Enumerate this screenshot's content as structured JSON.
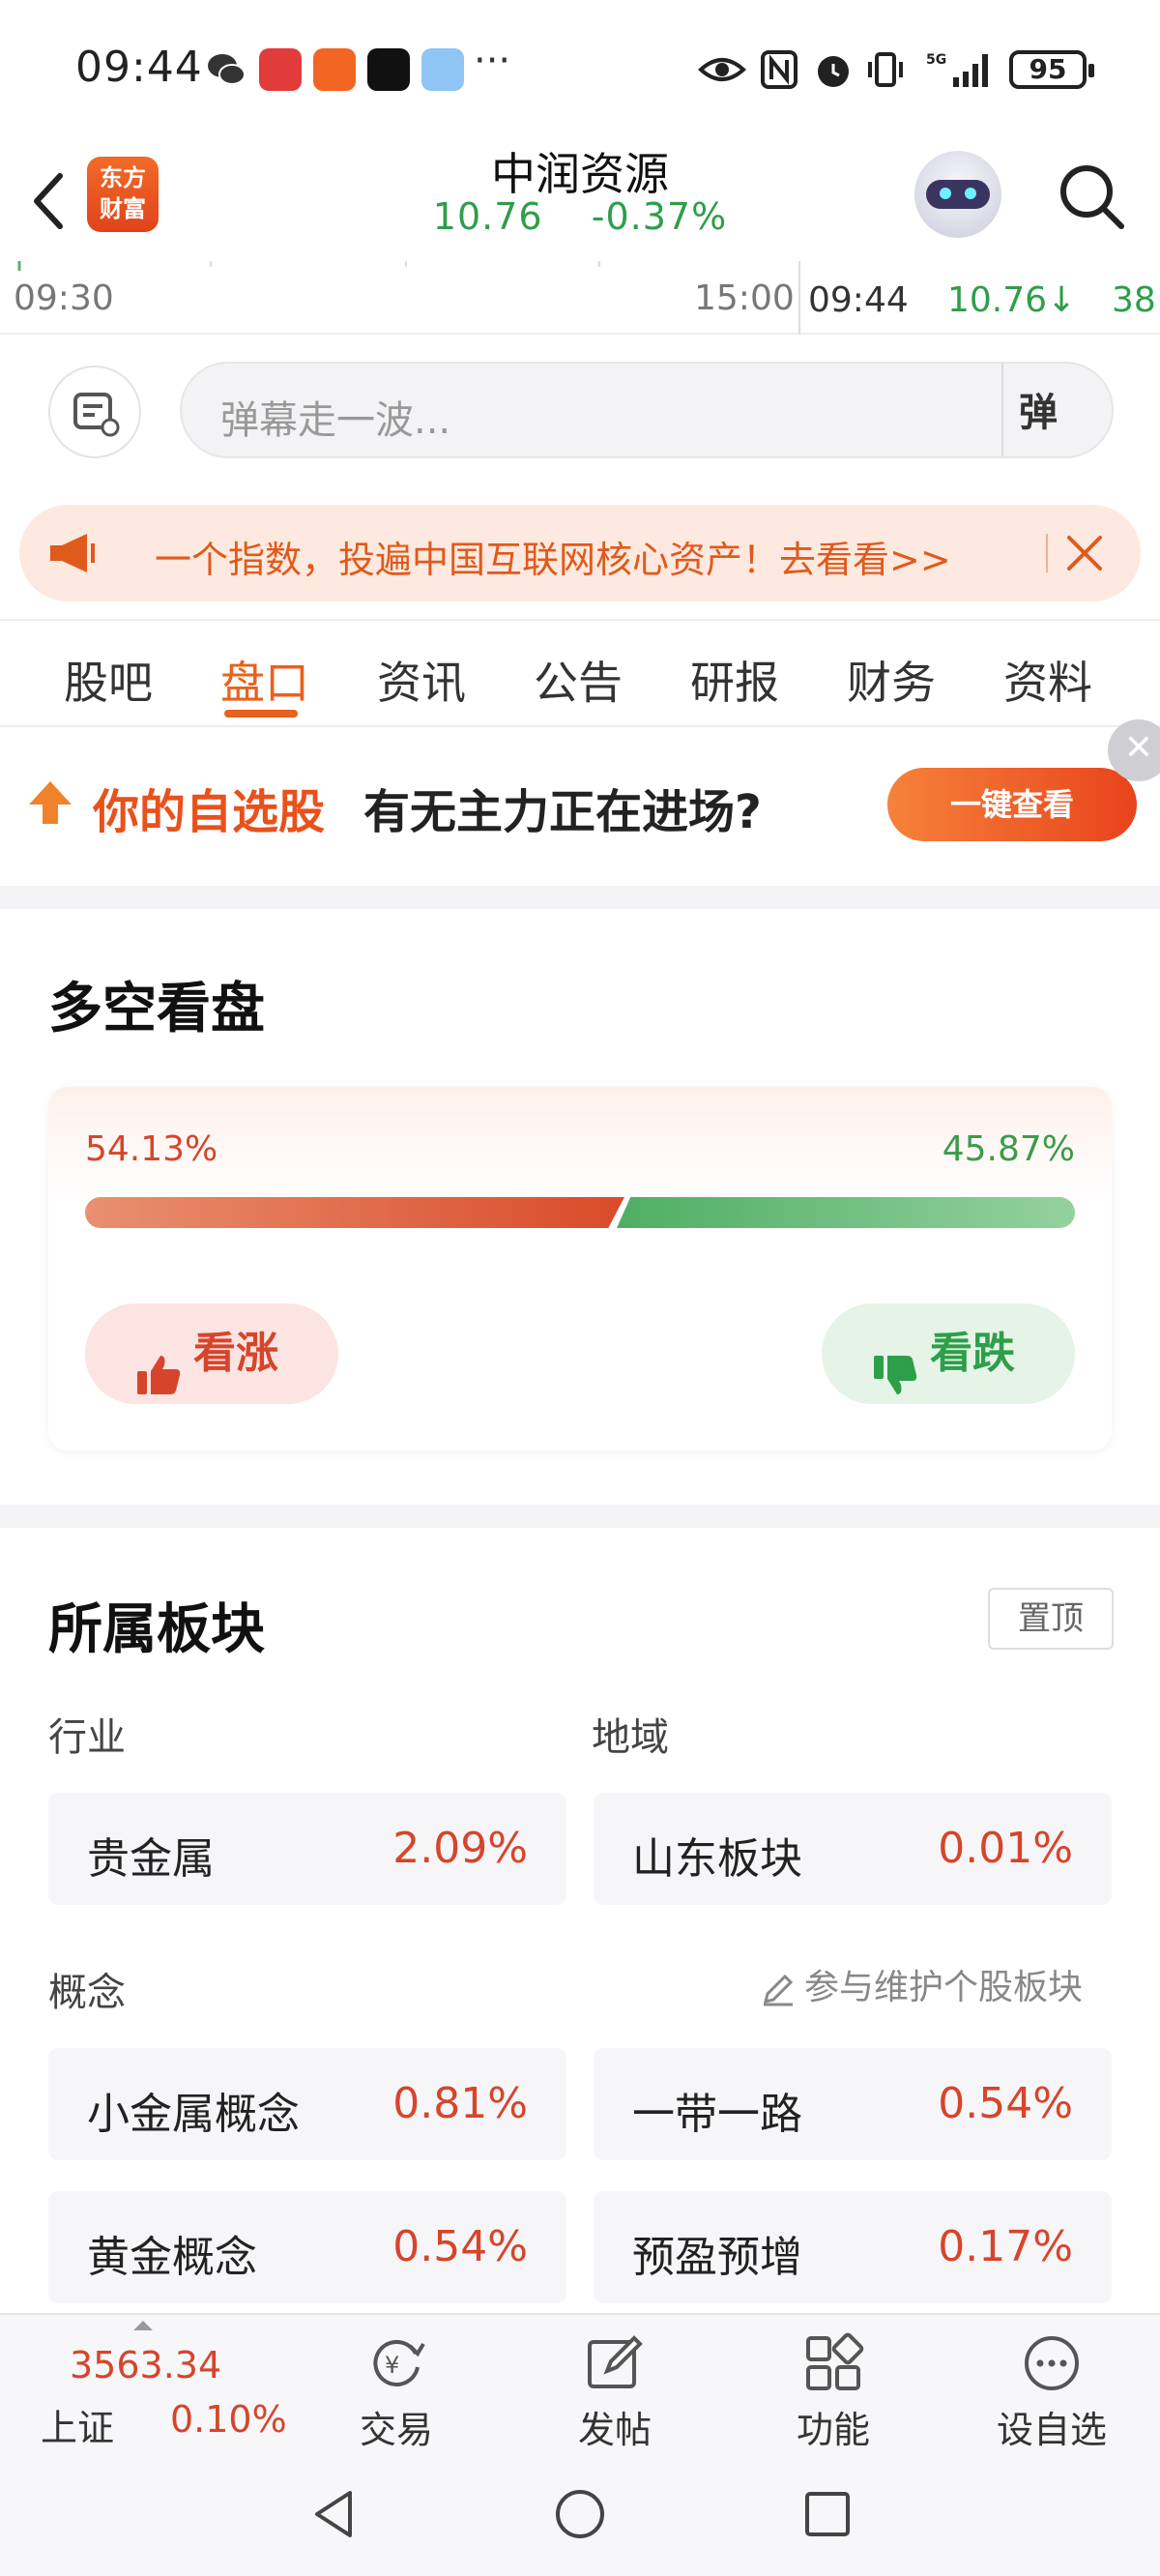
{
  "status_bar": {
    "time": "09:44",
    "battery": "95",
    "more_dots": "···"
  },
  "header": {
    "logo_text_line1": "东方",
    "logo_text_line2": "财富",
    "stock_name": "中润资源",
    "stock_price": "10.76",
    "stock_change": "-0.37%"
  },
  "strip": {
    "start_time": "09:30",
    "end_time": "15:00",
    "tick_time": "09:44",
    "tick_price": "10.76↓",
    "tick_volume": "38"
  },
  "danmaku": {
    "placeholder": "弹幕走一波...",
    "button": "弹"
  },
  "ad_banner": {
    "text": "一个指数，投遍中国互联网核心资产！去看看>>"
  },
  "tabs": [
    {
      "label": "股吧",
      "active": false
    },
    {
      "label": "盘口",
      "active": true
    },
    {
      "label": "资讯",
      "active": false
    },
    {
      "label": "公告",
      "active": false
    },
    {
      "label": "研报",
      "active": false
    },
    {
      "label": "财务",
      "active": false
    },
    {
      "label": "资料",
      "active": false
    }
  ],
  "promo": {
    "highlight": "你的自选股",
    "text": "有无主力正在进场?",
    "button": "一键查看",
    "close": "✕"
  },
  "long_short": {
    "title": "多空看盘",
    "bull_pct": "54.13%",
    "bear_pct": "45.87%",
    "bull_fraction": 0.5413,
    "bull_button": "看涨",
    "bear_button": "看跌"
  },
  "sectors": {
    "title": "所属板块",
    "pin_button": "置顶",
    "industry_label": "行业",
    "region_label": "地域",
    "concept_label": "概念",
    "maintain_link": "参与维护个股板块",
    "industry": {
      "name": "贵金属",
      "value": "2.09%"
    },
    "region": {
      "name": "山东板块",
      "value": "0.01%"
    },
    "concepts": [
      {
        "name": "小金属概念",
        "value": "0.81%"
      },
      {
        "name": "一带一路",
        "value": "0.54%"
      },
      {
        "name": "黄金概念",
        "value": "0.54%"
      },
      {
        "name": "预盈预增",
        "value": "0.17%"
      }
    ]
  },
  "bottom_bar": {
    "index_value": "3563.34",
    "index_name": "上证",
    "index_pct": "0.10%",
    "nav": [
      {
        "label": "交易"
      },
      {
        "label": "发帖"
      },
      {
        "label": "功能"
      },
      {
        "label": "设自选"
      }
    ]
  },
  "colors": {
    "accent": "#e9611c",
    "up": "#d6452b",
    "down": "#2e9e4a"
  }
}
